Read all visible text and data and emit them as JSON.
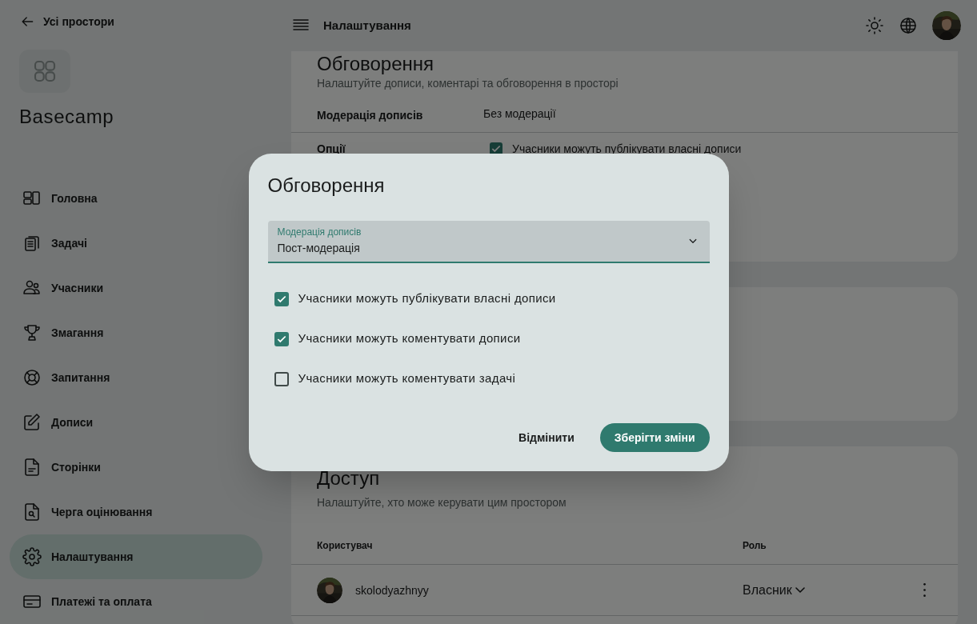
{
  "sidebar": {
    "back_link": "Усі простори",
    "space_name": "Basecamp",
    "items": [
      {
        "label": "Головна",
        "kind": "dashboard",
        "selected": false
      },
      {
        "label": "Задачі",
        "kind": "tasks",
        "selected": false
      },
      {
        "label": "Учасники",
        "kind": "people",
        "selected": false
      },
      {
        "label": "Змагання",
        "kind": "trophy",
        "selected": false
      },
      {
        "label": "Запитання",
        "kind": "lifebuoy",
        "selected": false
      },
      {
        "label": "Дописи",
        "kind": "pencil",
        "selected": false
      },
      {
        "label": "Сторінки",
        "kind": "document",
        "selected": false
      },
      {
        "label": "Черга оцінювання",
        "kind": "review",
        "selected": false
      },
      {
        "label": "Налаштування",
        "kind": "gear",
        "selected": true
      },
      {
        "label": "Платежі та оплата",
        "kind": "card",
        "selected": false
      }
    ]
  },
  "header": {
    "title": "Налаштування"
  },
  "discussion_section": {
    "title": "Обговорення",
    "subtitle": "Налаштуйте дописи, коментарі та обговорення в просторі",
    "moderation": {
      "label": "Модерація дописів",
      "value": "Без модерації"
    },
    "options": {
      "label": "Опції",
      "items": [
        {
          "label": "Учасники можуть публікувати власні дописи",
          "checked": true
        }
      ]
    }
  },
  "access_section": {
    "title": "Доступ",
    "subtitle": "Налаштуйте, хто може керувати цим простором",
    "columns": [
      "Користувач",
      "Роль"
    ],
    "rows": [
      {
        "user": "skolodyazhnyy",
        "role": "Власник"
      }
    ]
  },
  "dialog": {
    "title": "Обговорення",
    "select": {
      "label": "Модерація дописів",
      "value": "Пост-модерація"
    },
    "options": [
      {
        "label": "Учасники можуть публікувати власні дописи",
        "checked": true
      },
      {
        "label": "Учасники можуть коментувати дописи",
        "checked": true
      },
      {
        "label": "Учасники можуть коментувати задачі",
        "checked": false
      }
    ],
    "cancel": "Відмінити",
    "save": "Зберігти зміни"
  }
}
